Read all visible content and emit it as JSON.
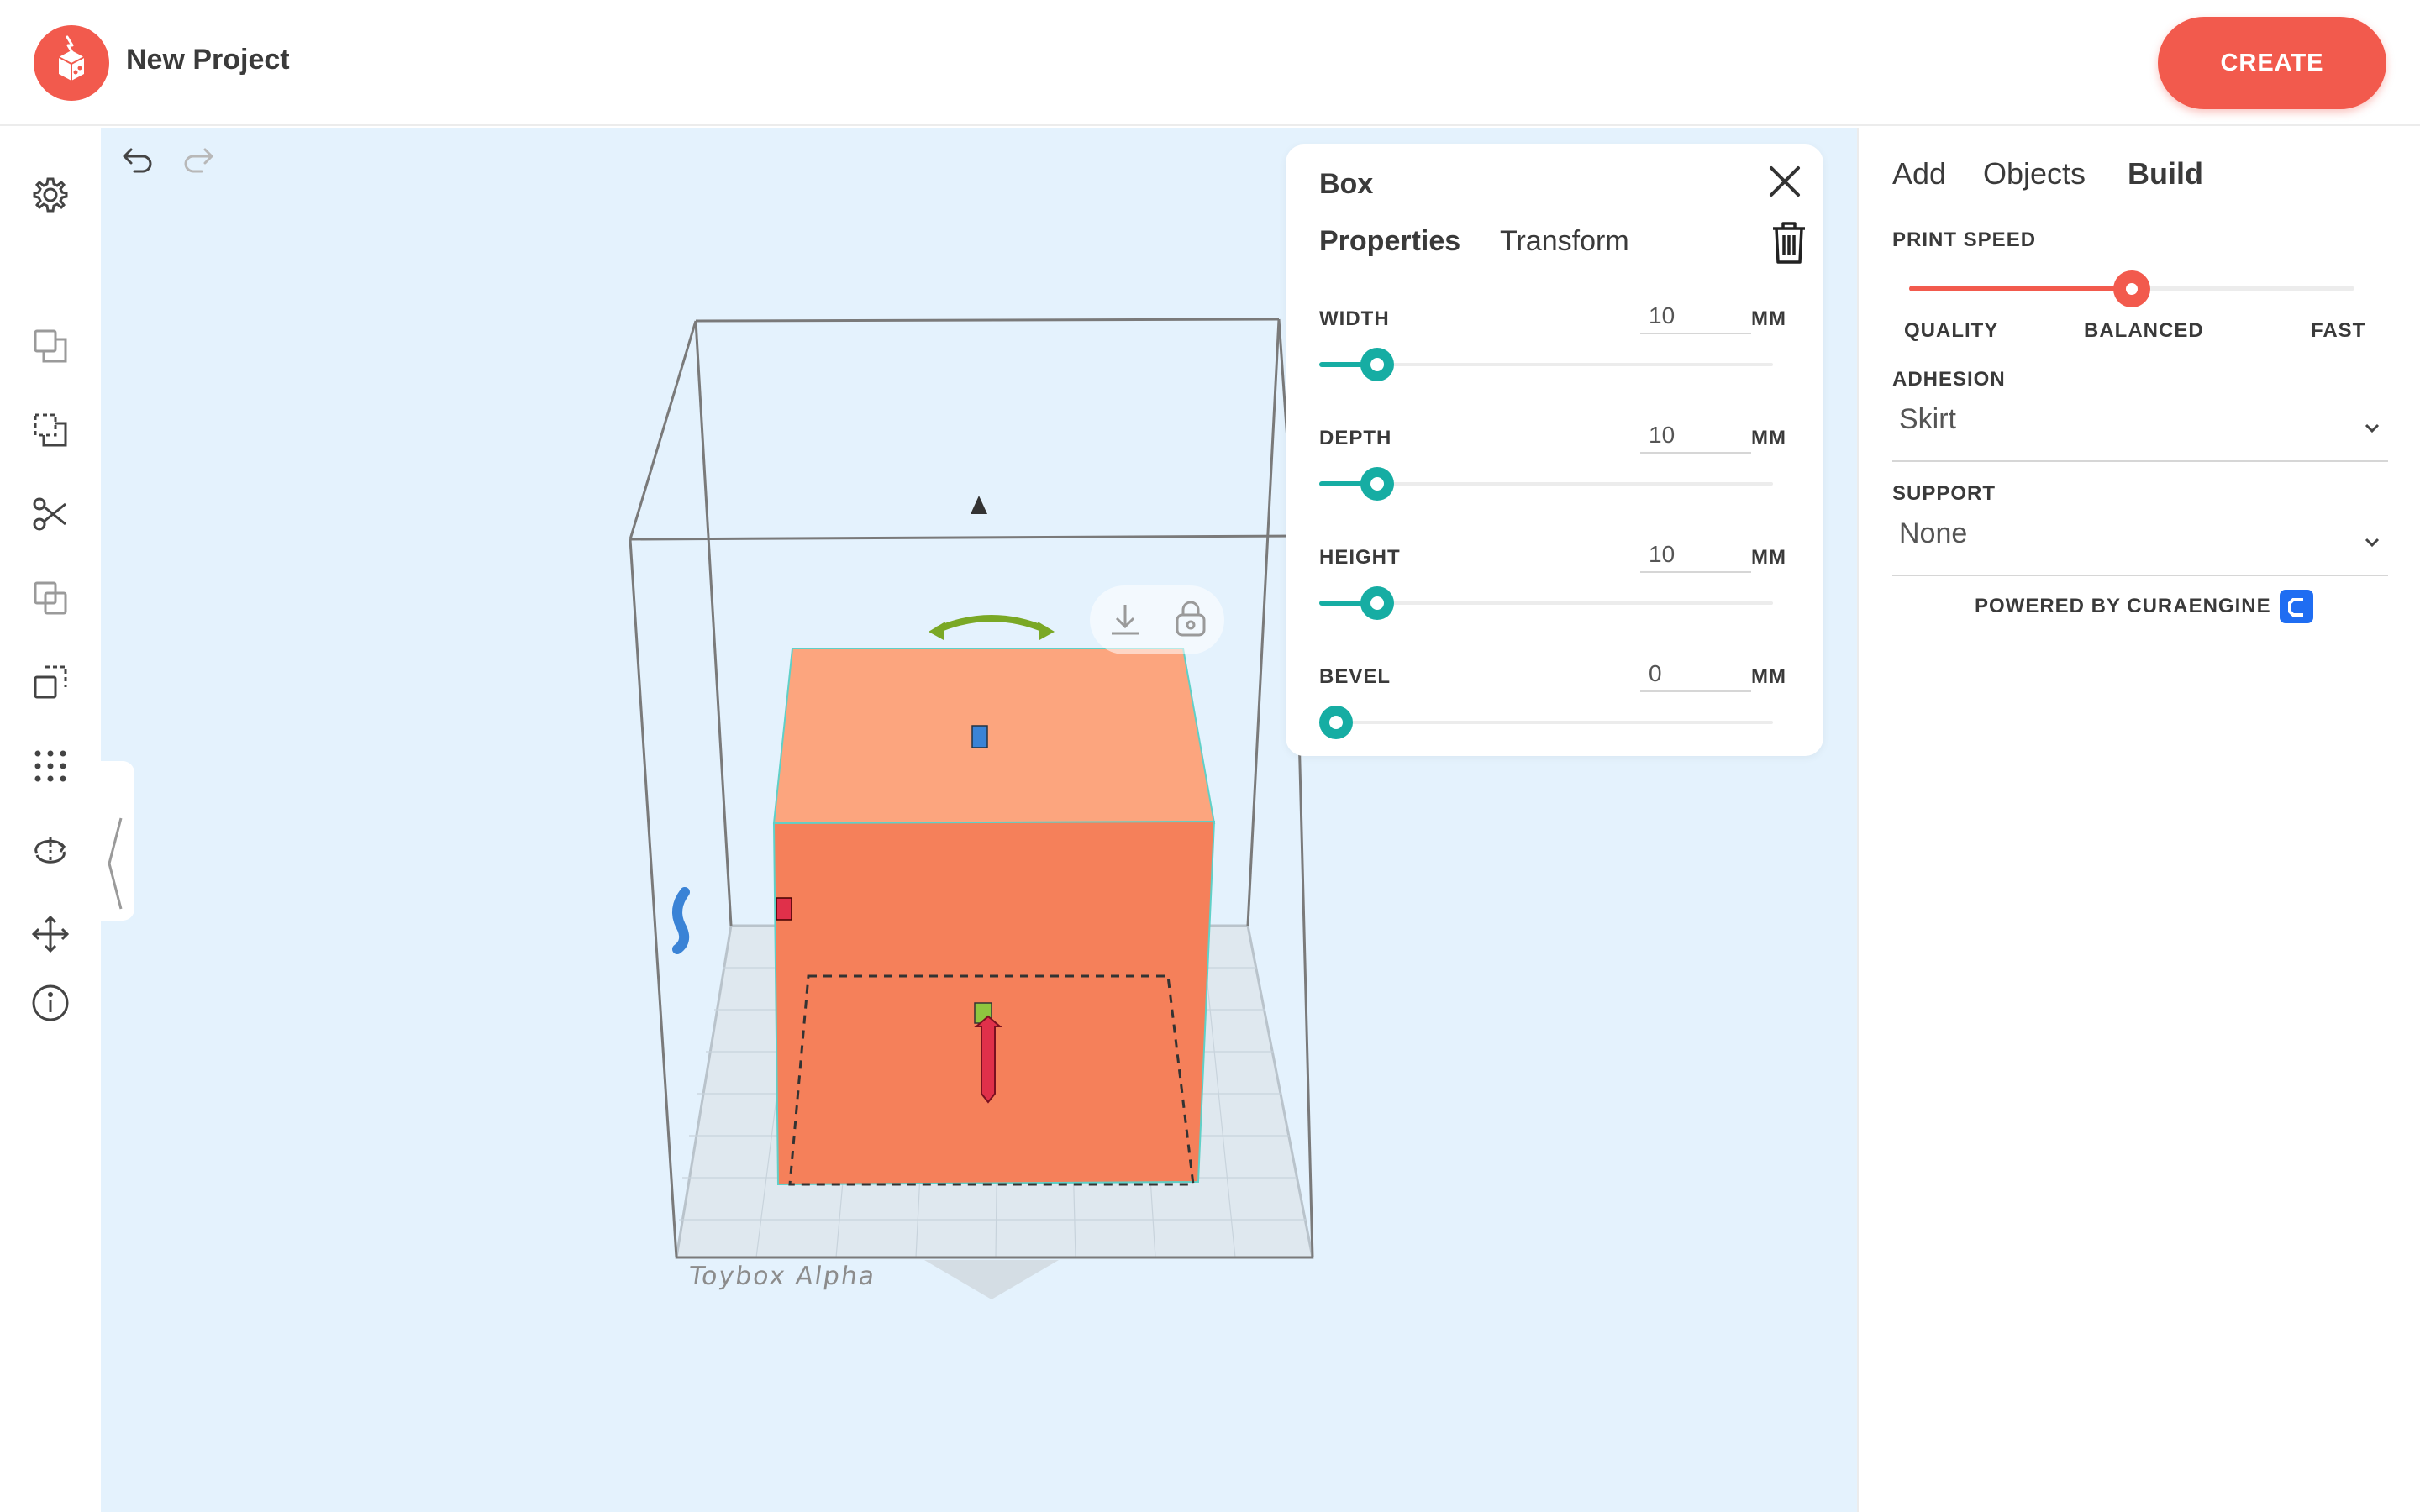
{
  "header": {
    "project_title": "New Project",
    "create_label": "CREATE"
  },
  "toolbar": {
    "tools": [
      {
        "name": "settings",
        "icon": "gear-icon"
      },
      {
        "name": "copy",
        "icon": "copy-icon"
      },
      {
        "name": "paste",
        "icon": "paste-icon"
      },
      {
        "name": "cut",
        "icon": "scissors-icon"
      },
      {
        "name": "group",
        "icon": "group-icon"
      },
      {
        "name": "duplicate",
        "icon": "duplicate-icon"
      },
      {
        "name": "pattern",
        "icon": "grid-dots-icon"
      },
      {
        "name": "rotate",
        "icon": "rotate-icon"
      },
      {
        "name": "move",
        "icon": "move-arrows-icon"
      },
      {
        "name": "info",
        "icon": "info-icon"
      }
    ]
  },
  "viewport": {
    "plate_label": "Toybox Alpha",
    "object_color": "#f5805a",
    "object_top_color": "#fca57e",
    "background": "#e4f2fd"
  },
  "properties_card": {
    "title": "Box",
    "tabs": [
      {
        "label": "Properties",
        "active": true
      },
      {
        "label": "Transform",
        "active": false
      }
    ],
    "fields": [
      {
        "label": "WIDTH",
        "value": "10",
        "unit": "MM",
        "fraction": 0.09
      },
      {
        "label": "DEPTH",
        "value": "10",
        "unit": "MM",
        "fraction": 0.09
      },
      {
        "label": "HEIGHT",
        "value": "10",
        "unit": "MM",
        "fraction": 0.09
      },
      {
        "label": "BEVEL",
        "value": "0",
        "unit": "MM",
        "fraction": 0.0
      }
    ],
    "accent": "#16ada3"
  },
  "right_panel": {
    "tabs": [
      {
        "label": "Add",
        "active": false
      },
      {
        "label": "Objects",
        "active": false
      },
      {
        "label": "Build",
        "active": true
      }
    ],
    "print_speed": {
      "label": "PRINT SPEED",
      "stops": [
        "QUALITY",
        "BALANCED",
        "FAST"
      ],
      "selected": "BALANCED",
      "fraction": 0.5
    },
    "adhesion": {
      "label": "ADHESION",
      "value": "Skirt"
    },
    "support": {
      "label": "SUPPORT",
      "value": "None"
    },
    "powered_by": "POWERED BY CURAENGINE",
    "accent": "#f25a4d"
  }
}
